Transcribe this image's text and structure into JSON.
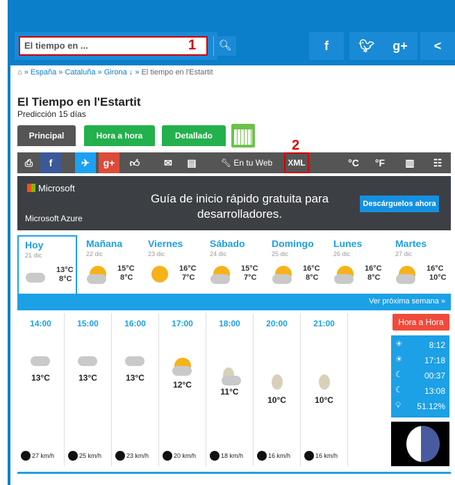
{
  "search": {
    "placeholder": "El tiempo en ...",
    "badge": "1"
  },
  "social": [
    "f",
    "y",
    "g+",
    "share"
  ],
  "breadcrumb": {
    "home_icon": "home-icon",
    "items": [
      "España",
      "Cataluña",
      "Girona ↓",
      "El tiempo en l'Estartit"
    ]
  },
  "page": {
    "title": "El Tiempo en l'Estartit",
    "subtitle": "Predicción 15 días"
  },
  "tabs": [
    "Principal",
    "Hora a hora",
    "Detallado"
  ],
  "xml_badge": "2",
  "toolbar": {
    "labels": {
      "web": "En tu Web",
      "xml": "XML",
      "celsius": "°C",
      "fahrenheit": "°F"
    }
  },
  "ad": {
    "brand": "Microsoft",
    "product": "Microsoft Azure",
    "headline": "Guía de inicio rápido gratuita para desarrolladores.",
    "cta": "Descárguelos ahora"
  },
  "days": [
    {
      "name": "Hoy",
      "date": "21 dic",
      "max": "13°C",
      "min": "8°C",
      "icon": "cloud-icon"
    },
    {
      "name": "Mañana",
      "date": "22 dic",
      "max": "15°C",
      "min": "8°C",
      "icon": "partly-cloudy-icon"
    },
    {
      "name": "Viernes",
      "date": "23 dic",
      "max": "16°C",
      "min": "7°C",
      "icon": "sun-icon"
    },
    {
      "name": "Sábado",
      "date": "24 dic",
      "max": "15°C",
      "min": "7°C",
      "icon": "partly-cloudy-icon"
    },
    {
      "name": "Domingo",
      "date": "25 dic",
      "max": "16°C",
      "min": "8°C",
      "icon": "partly-cloudy-icon"
    },
    {
      "name": "Lunes",
      "date": "26 dic",
      "max": "16°C",
      "min": "8°C",
      "icon": "partly-cloudy-icon"
    },
    {
      "name": "Martes",
      "date": "27 dic",
      "max": "16°C",
      "min": "10°C",
      "icon": "partly-cloudy-icon"
    }
  ],
  "next_week": "Ver próxima semana »",
  "hours": [
    {
      "time": "14:00",
      "temp": "13°C",
      "wind": "27 km/h",
      "icon": "cloud-icon"
    },
    {
      "time": "15:00",
      "temp": "13°C",
      "wind": "25 km/h",
      "icon": "cloud-icon"
    },
    {
      "time": "16:00",
      "temp": "13°C",
      "wind": "23 km/h",
      "icon": "cloud-icon"
    },
    {
      "time": "17:00",
      "temp": "12°C",
      "wind": "20 km/h",
      "icon": "partly-cloudy-icon"
    },
    {
      "time": "18:00",
      "temp": "11°C",
      "wind": "18 km/h",
      "icon": "night-cloud-icon"
    },
    {
      "time": "20:00",
      "temp": "10°C",
      "wind": "16 km/h",
      "icon": "moon-icon"
    },
    {
      "time": "21:00",
      "temp": "10°C",
      "wind": "16 km/h",
      "icon": "moon-icon"
    }
  ],
  "hora_a_hora": "Hora a Hora",
  "sun": [
    {
      "icon": "sunrise-icon",
      "value": "8:12"
    },
    {
      "icon": "sunset-icon",
      "value": "17:18"
    },
    {
      "icon": "moonrise-icon",
      "value": "00:37"
    },
    {
      "icon": "moonset-icon",
      "value": "13:08"
    },
    {
      "icon": "moon-illumination-icon",
      "value": "51.12%"
    }
  ]
}
